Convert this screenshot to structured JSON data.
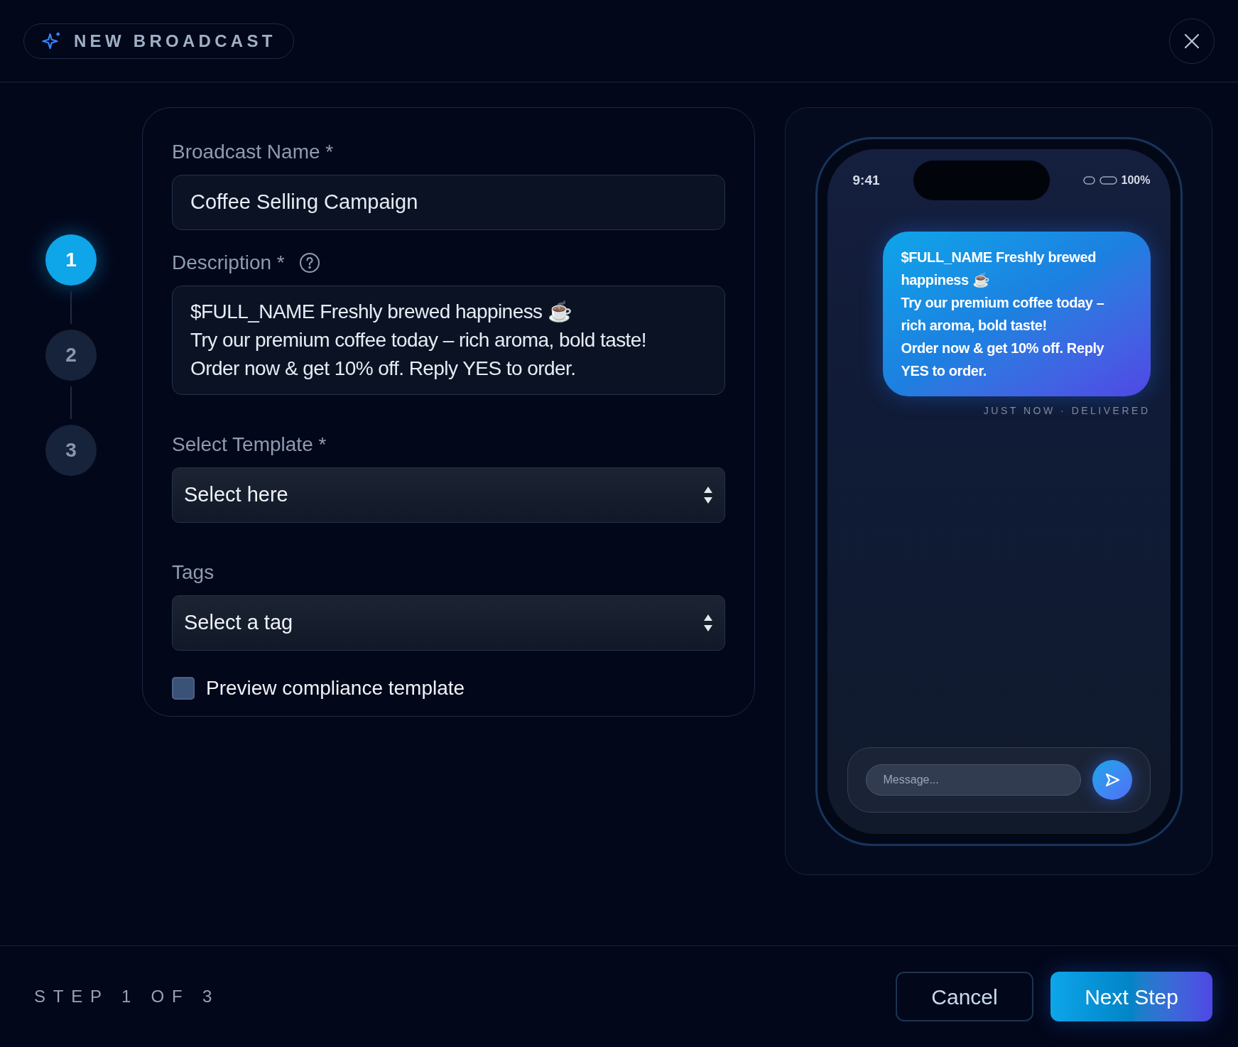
{
  "header": {
    "title": "NEW BROADCAST"
  },
  "steps": [
    {
      "label": "1",
      "selected": true
    },
    {
      "label": "2",
      "selected": false
    },
    {
      "label": "3",
      "selected": false
    }
  ],
  "form": {
    "name_label": "Broadcast Name *",
    "name_value": "Coffee Selling Campaign",
    "description_label": "Description *",
    "description_lines": [
      "$FULL_NAME Freshly brewed happiness ☕",
      "Try our premium coffee today – rich aroma, bold taste!",
      "Order now & get 10% off. Reply YES to order."
    ],
    "template_label": "Select Template *",
    "template_placeholder": "Select here",
    "tags_label": "Tags",
    "tags_placeholder": "Select a tag",
    "compliance": {
      "label": "Preview compliance template",
      "checked": false
    }
  },
  "phone": {
    "time": "9:41",
    "battery": "100%",
    "message_lines": [
      "$FULL_NAME Freshly brewed happiness ☕",
      "Try our premium coffee today – rich aroma, bold taste!",
      "Order now & get 10% off. Reply YES to order."
    ],
    "message_status": "JUST NOW · DELIVERED",
    "input_placeholder": "Message..."
  },
  "footer": {
    "step_text": "STEP 1 OF 3",
    "cancel": "Cancel",
    "next": "Next Step"
  }
}
